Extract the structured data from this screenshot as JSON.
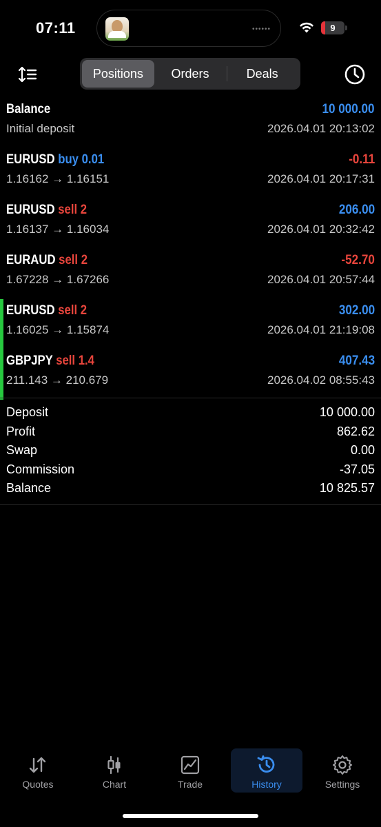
{
  "status_bar": {
    "time": "07:11",
    "battery": "9",
    "island_dots": "••••••"
  },
  "toolbar": {
    "tabs": [
      {
        "label": "Positions",
        "active": true
      },
      {
        "label": "Orders",
        "active": false
      },
      {
        "label": "Deals",
        "active": false
      }
    ],
    "sort_icon": "sort-icon",
    "history_icon": "clock-icon"
  },
  "deals": [
    {
      "symbol": "Balance",
      "side": "",
      "volume": "",
      "amount": "10 000.00",
      "sub": "Initial deposit",
      "date": "2026.04.01 20:13:02"
    },
    {
      "symbol": "EURUSD",
      "side": "buy",
      "volume": "0.01",
      "amount": "-0.11",
      "sub": "1.16162 → 1.16151",
      "date": "2026.04.01 20:17:31"
    },
    {
      "symbol": "EURUSD",
      "side": "sell",
      "volume": "2",
      "amount": "206.00",
      "sub": "1.16137 → 1.16034",
      "date": "2026.04.01 20:32:42"
    },
    {
      "symbol": "EURAUD",
      "side": "sell",
      "volume": "2",
      "amount": "-52.70",
      "sub": "1.67228 → 1.67266",
      "date": "2026.04.01 20:57:44"
    },
    {
      "symbol": "EURUSD",
      "side": "sell",
      "volume": "2",
      "amount": "302.00",
      "sub": "1.16025 → 1.15874",
      "date": "2026.04.01 21:19:08"
    },
    {
      "symbol": "GBPJPY",
      "side": "sell",
      "volume": "1.4",
      "amount": "407.43",
      "sub": "211.143 → 210.679",
      "date": "2026.04.02 08:55:43"
    }
  ],
  "colors": {
    "positive": "#3a8ef0",
    "negative": "#e8453c",
    "marker": "#27c93f"
  },
  "summary": [
    {
      "label": "Deposit",
      "value": "10 000.00"
    },
    {
      "label": "Profit",
      "value": "862.62"
    },
    {
      "label": "Swap",
      "value": "0.00"
    },
    {
      "label": "Commission",
      "value": "-37.05"
    },
    {
      "label": "Balance",
      "value": "10 825.57"
    }
  ],
  "tabbar": [
    {
      "label": "Quotes",
      "icon": "quotes-icon",
      "active": false
    },
    {
      "label": "Chart",
      "icon": "candlestick-icon",
      "active": false
    },
    {
      "label": "Trade",
      "icon": "trade-chart-icon",
      "active": false
    },
    {
      "label": "History",
      "icon": "history-icon",
      "active": true
    },
    {
      "label": "Settings",
      "icon": "gear-icon",
      "active": false
    }
  ]
}
